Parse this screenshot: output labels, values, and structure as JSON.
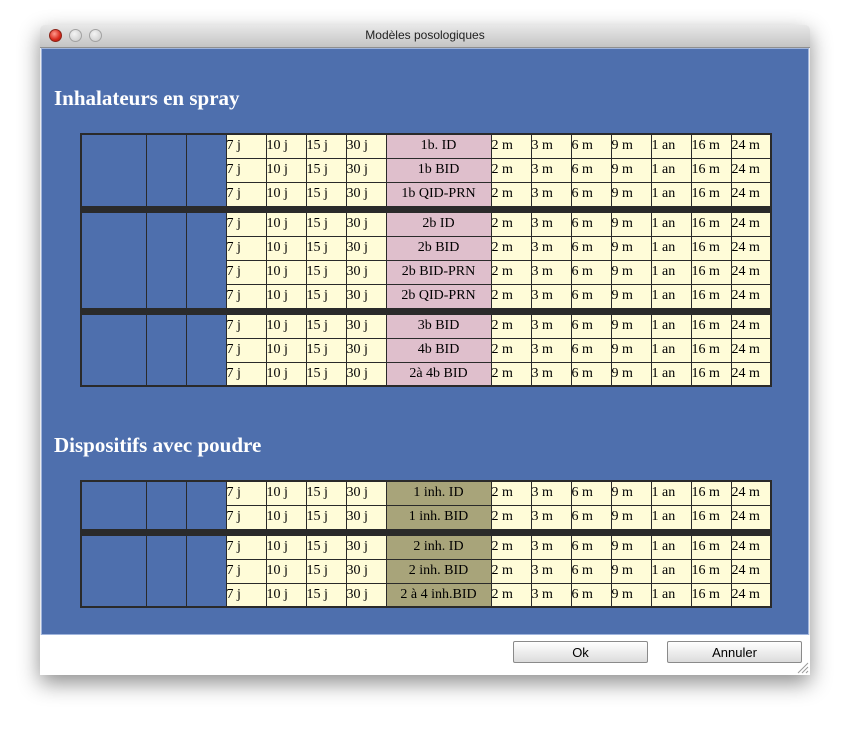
{
  "window": {
    "title": "Modèles posologiques"
  },
  "sections": [
    {
      "title": "Inhalateurs en spray",
      "groups": [
        [
          "1b. ID",
          "1b BID",
          "1b QID-PRN"
        ],
        [
          "2b ID",
          "2b BID",
          "2b BID-PRN",
          "2b QID-PRN"
        ],
        [
          "3b BID",
          "4b BID",
          "2à 4b BID"
        ]
      ]
    },
    {
      "title": "Dispositifs avec poudre",
      "groups": [
        [
          "1 inh. ID",
          "1 inh. BID"
        ],
        [
          "2 inh. ID",
          "2 inh. BID",
          "2 à 4 inh.BID"
        ]
      ]
    }
  ],
  "short_durations": [
    "7 j",
    "10 j",
    "15 j",
    "30 j"
  ],
  "long_durations": [
    "2 m",
    "3 m",
    "6 m",
    "9 m",
    "1 an",
    "16 m",
    "24 m"
  ],
  "colors": {
    "panel_blue": "#4e6fad",
    "spray_cell": "#dfbfcc",
    "powder_cell": "#a8a47a",
    "duration_cell": "#fffcd8"
  },
  "buttons": {
    "ok": "Ok",
    "cancel": "Annuler"
  }
}
